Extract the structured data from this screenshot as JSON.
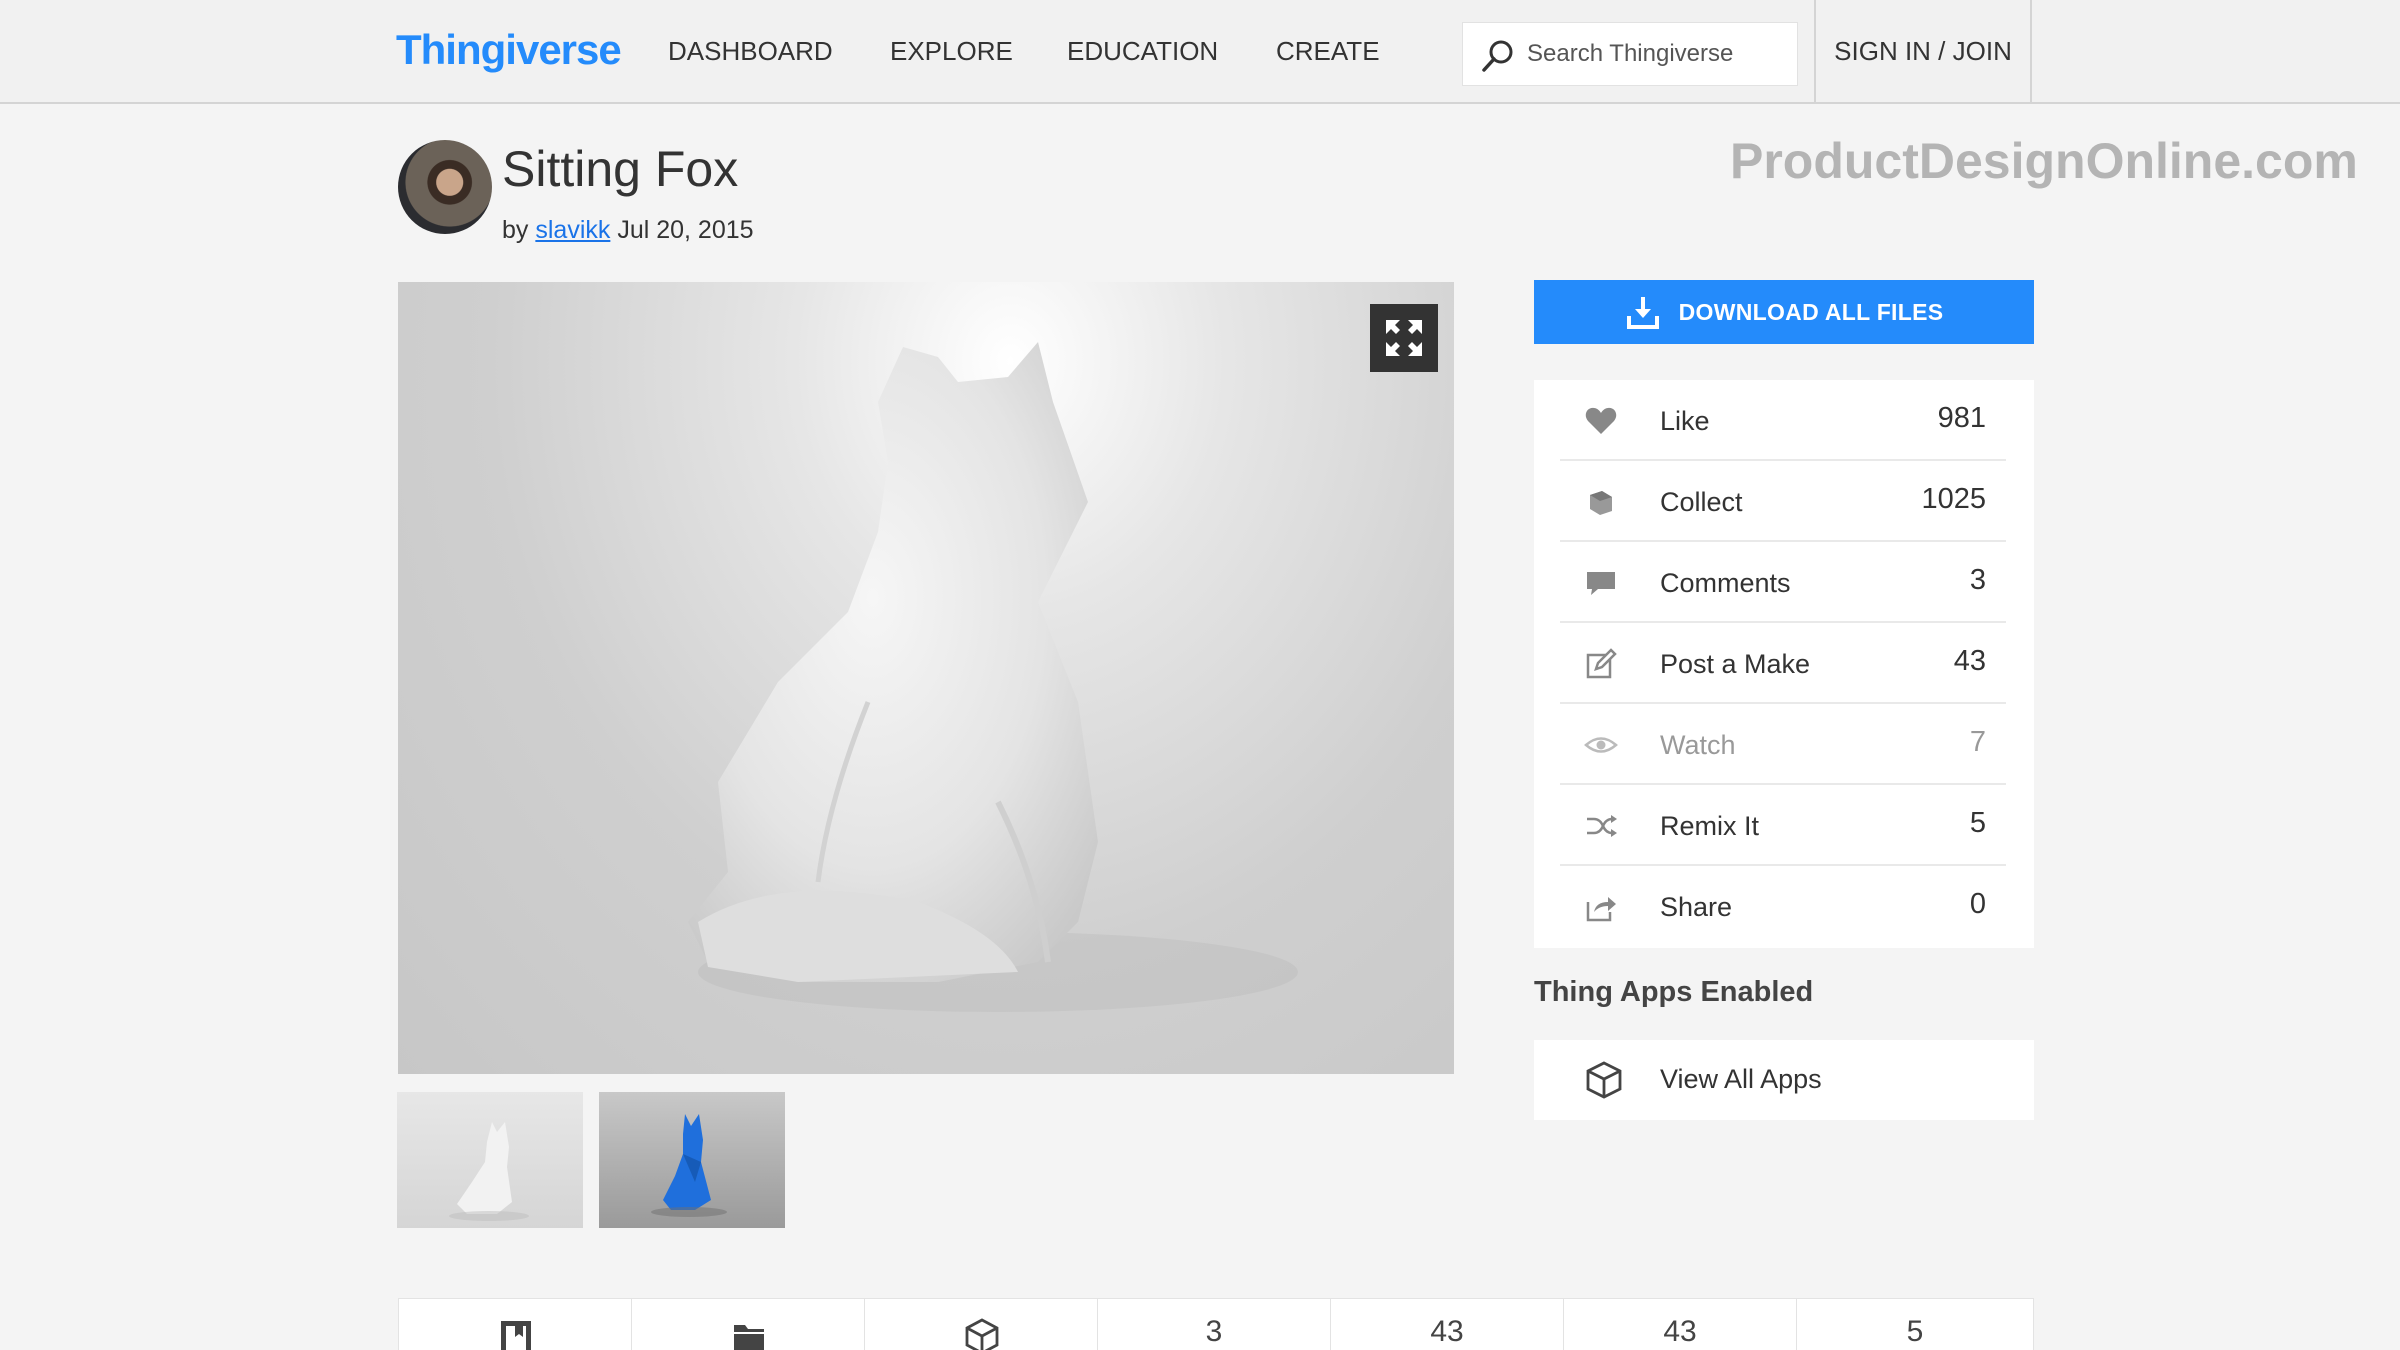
{
  "header": {
    "logo": "Thingiverse",
    "nav": [
      "DASHBOARD",
      "EXPLORE",
      "EDUCATION",
      "CREATE"
    ],
    "search_placeholder": "Search Thingiverse",
    "sign_in": "SIGN IN / JOIN"
  },
  "thing": {
    "title": "Sitting Fox",
    "by_prefix": "by",
    "author": "slavikk",
    "date": "Jul 20, 2015"
  },
  "watermark": "ProductDesignOnline.com",
  "sidebar": {
    "download_label": "DOWNLOAD ALL FILES",
    "stats": [
      {
        "label": "Like",
        "count": "981",
        "icon": "heart-icon"
      },
      {
        "label": "Collect",
        "count": "1025",
        "icon": "collect-icon"
      },
      {
        "label": "Comments",
        "count": "3",
        "icon": "comments-icon"
      },
      {
        "label": "Post a Make",
        "count": "43",
        "icon": "pencil-icon"
      },
      {
        "label": "Watch",
        "count": "7",
        "icon": "eye-icon"
      },
      {
        "label": "Remix It",
        "count": "5",
        "icon": "shuffle-icon"
      },
      {
        "label": "Share",
        "count": "0",
        "icon": "share-icon"
      }
    ],
    "apps_heading": "Thing Apps Enabled",
    "apps_link": "View All Apps"
  },
  "tabs": [
    {
      "icon": "book-icon",
      "count": ""
    },
    {
      "icon": "folder-icon",
      "count": ""
    },
    {
      "icon": "cube-icon",
      "count": ""
    },
    {
      "icon": "",
      "count": "3"
    },
    {
      "icon": "",
      "count": "43"
    },
    {
      "icon": "",
      "count": "43"
    },
    {
      "icon": "",
      "count": "5"
    }
  ],
  "colors": {
    "brand_blue": "#248bfb",
    "link_blue": "#1a73e8",
    "watermark_gray": "#b4b4b4"
  }
}
